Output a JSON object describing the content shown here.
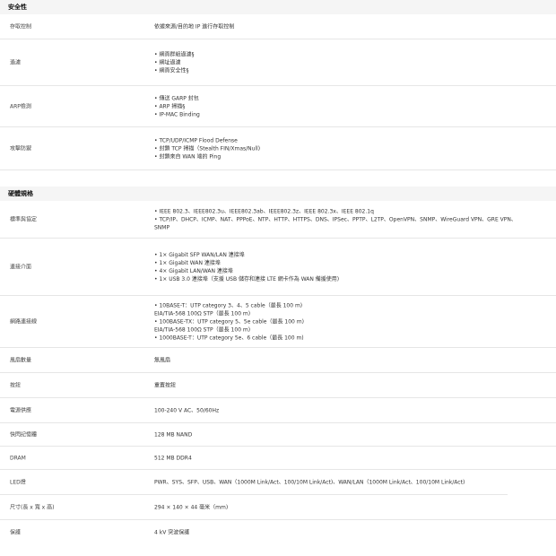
{
  "security": {
    "title": "安全性",
    "rows": [
      {
        "label": "存取控制",
        "lines": [
          "依據來源/目的地 IP 進行存取控制"
        ]
      },
      {
        "label": "過濾",
        "lines": [
          "網頁群組過濾§",
          "網址過濾",
          "網頁安全性§"
        ],
        "bullets": true
      },
      {
        "label": "ARP檢測",
        "lines": [
          "傳送 GARP 封包",
          "ARP 掃描§",
          "IP-MAC Binding"
        ],
        "bullets": true
      },
      {
        "label": "攻擊防禦",
        "lines": [
          "TCP/UDP/ICMP Flood Defense",
          "封鎖 TCP 掃描（Stealth FIN/Xmas/Null)",
          "封鎖來自 WAN 端的 Ping"
        ],
        "bullets": true
      }
    ]
  },
  "hardware": {
    "title": "硬體規格",
    "rows": [
      {
        "label": "標準與協定",
        "lines": [
          "• IEEE 802.3、IEEE802.3u、IEEE802.3ab、IEEE802.3z、IEEE 802.3x、IEEE 802.1q",
          "• TCP/IP、DHCP、ICMP、NAT、PPPoE、NTP、HTTP、HTTPS、DNS、IPSec、PPTP、L2TP、OpenVPN、SNMP、WireGuard VPN、GRE VPN、",
          "SNMP"
        ]
      },
      {
        "label": "連接介面",
        "lines": [
          "• 1× Gigabit SFP WAN/LAN 連接埠",
          "• 1× Gigabit WAN 連接埠",
          "• 4× Gigabit LAN/WAN 連接埠",
          "• 1× USB 3.0 連接埠（支援 USB 儲存和連接 LTE 網卡作為 WAN 備援使用)"
        ]
      },
      {
        "label": "網路連接線",
        "lines": [
          "• 10BASE-T：UTP category 3、4、5 cable（最長 100 m)",
          "EIA/TIA-568 100Ω STP（最長 100 m)",
          "• 100BASE-TX：UTP category 5、5e cable（最長 100 m)",
          "EIA/TIA-568 100Ω STP（最長 100 m)",
          "• 1000BASE-T：UTP category 5e、6 cable（最長 100 m)"
        ]
      },
      {
        "label": "風扇數量",
        "lines": [
          "無風扇"
        ]
      },
      {
        "label": "按鈕",
        "lines": [
          "重置按鈕"
        ]
      },
      {
        "label": "電源供應",
        "lines": [
          "100-240 V AC、50/60Hz"
        ]
      },
      {
        "label": "快閃記憶體",
        "lines": [
          "128 MB NAND"
        ]
      },
      {
        "label": "DRAM",
        "lines": [
          "512 MB DDR4"
        ]
      },
      {
        "label": "LED燈",
        "lines": [
          "PWR、SYS、SFP、USB、WAN（1000M Link/Act、100/10M Link/Act)、WAN/LAN（1000M Link/Act、100/10M Link/Act)"
        ]
      },
      {
        "label": "尺寸(長 x 寬 x 高)",
        "lines": [
          "294 × 140 × 44 毫米（mm)"
        ]
      },
      {
        "label": "保護",
        "lines": [
          "4 kV 突波保護"
        ]
      }
    ]
  }
}
